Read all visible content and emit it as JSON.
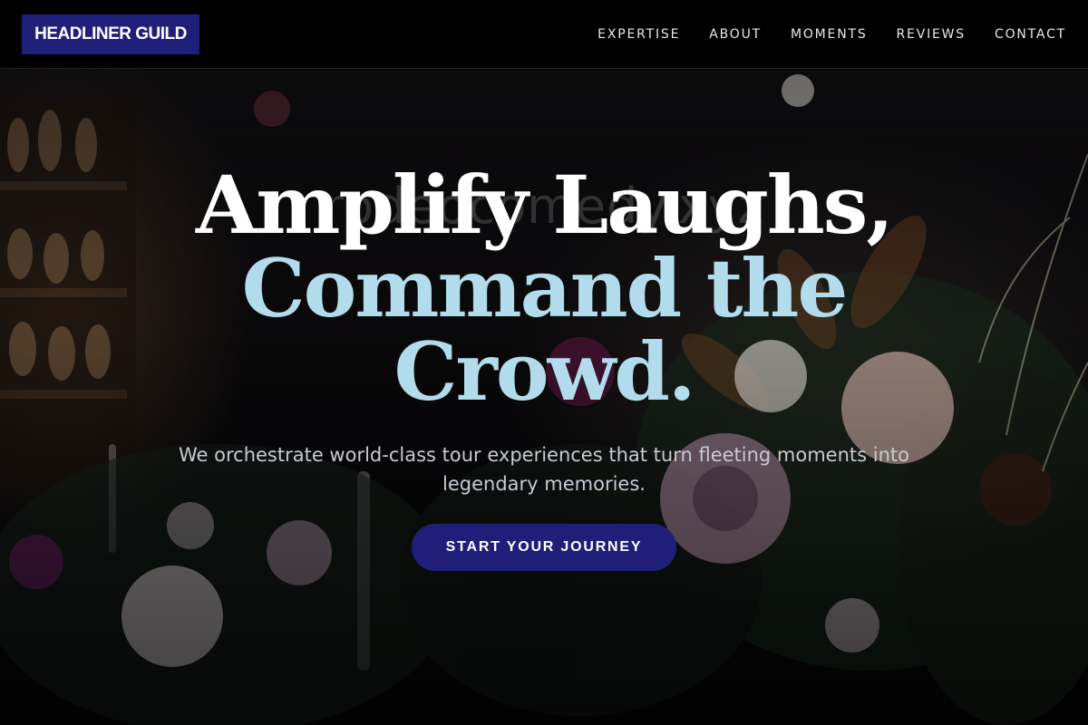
{
  "nav": {
    "logo": "HEADLINER GUILD",
    "links": [
      "EXPERTISE",
      "ABOUT",
      "MOMENTS",
      "REVIEWS",
      "CONTACT"
    ]
  },
  "hero": {
    "headline_line1": "Amplify Laughs,",
    "headline_line2a": "Command the",
    "headline_line2b": "Crowd.",
    "watermark": "rodeocomedy.xyz",
    "subtitle": "We orchestrate world-class tour experiences that turn fleeting moments into legendary memories.",
    "cta_label": "START YOUR JOURNEY"
  },
  "colors": {
    "brand": "#1f1f7a",
    "headline_white": "#ffffff",
    "headline_accent": "#b2dcec",
    "nav_bg": "#000000"
  }
}
